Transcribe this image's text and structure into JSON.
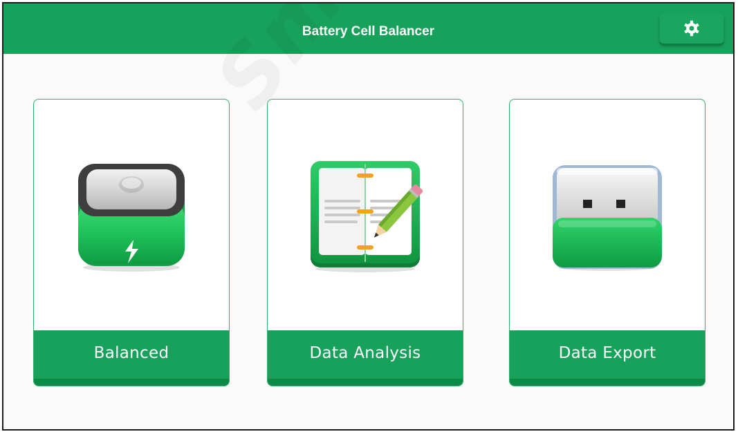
{
  "app": {
    "title": "Battery Cell Balancer",
    "settings_icon": "gear-icon",
    "watermark": "Safe Smart"
  },
  "menu": {
    "items": [
      {
        "label": "Balanced",
        "icon": "battery-icon"
      },
      {
        "label": "Data Analysis",
        "icon": "notebook-pencil-icon"
      },
      {
        "label": "Data Export",
        "icon": "usb-drive-icon"
      }
    ]
  },
  "colors": {
    "brand_green": "#18a15a",
    "dark_green": "#0d8a45",
    "border_green": "#2bb06a",
    "text_white": "#ffffff"
  }
}
